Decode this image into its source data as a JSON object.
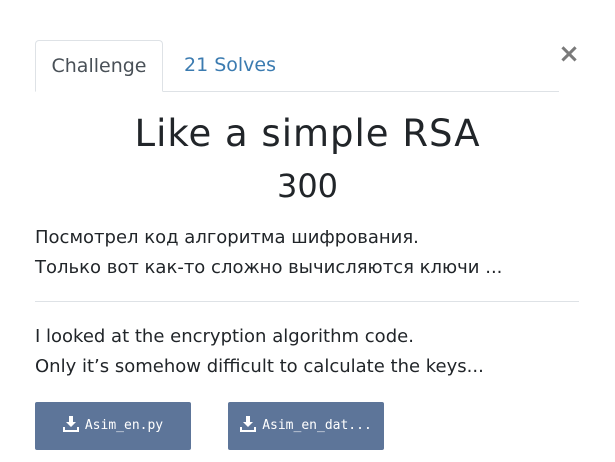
{
  "tabs": {
    "challenge_label": "Challenge",
    "solves_label": "21 Solves"
  },
  "close_label": "×",
  "challenge": {
    "title": "Like a simple RSA",
    "points": "300",
    "description_ru": [
      "Посмотрел код алгоритма шифрования.",
      "Только вот как-то сложно вычисляются ключи ..."
    ],
    "description_en": [
      "I looked at the encryption algorithm code.",
      "Only it’s somehow difficult to calculate the keys..."
    ]
  },
  "files": [
    {
      "label": "Asim_en.py",
      "icon": "download-icon"
    },
    {
      "label": "Asim_en_dat...",
      "icon": "download-icon"
    }
  ],
  "colors": {
    "file_button_bg": "#5d7599",
    "tab_link": "#3b7bb0",
    "close": "#7a7a7a"
  }
}
